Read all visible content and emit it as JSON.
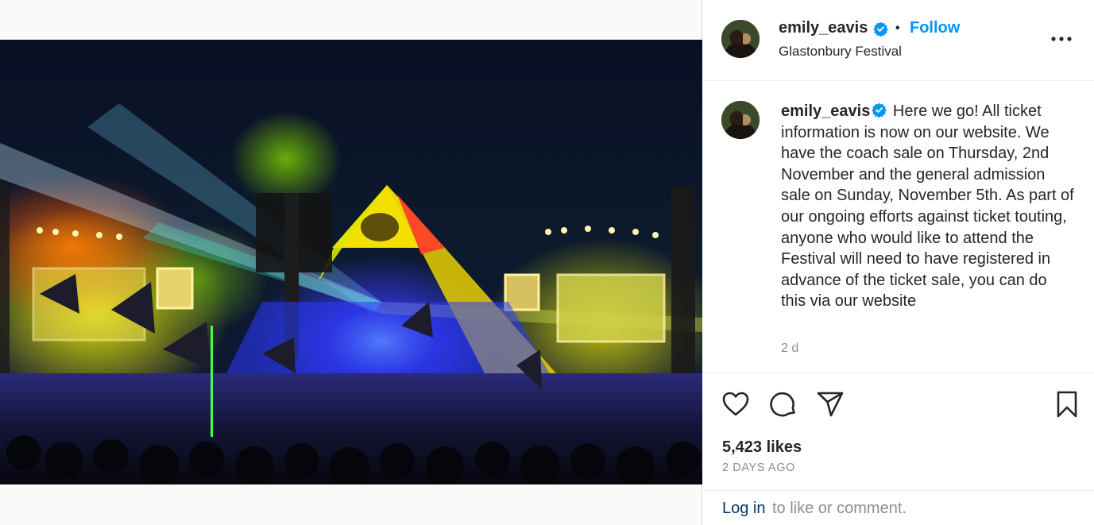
{
  "post": {
    "username": "emily_eavis",
    "follow_label": "Follow",
    "separator": "•",
    "location": "Glastonbury Festival",
    "caption": "Here we go! All ticket information is now on our website. We have the coach sale on Thursday, 2nd November and the general admission sale on Sunday, November 5th. As part of our ongoing efforts against ticket touting, anyone who would like to attend the Festival will need to have registered in advance of the ticket sale, you can do this via our website",
    "time_ago": "2 d",
    "likes": "5,423 likes",
    "date": "2 DAYS AGO"
  },
  "login": {
    "link_label": "Log in",
    "rest": "to like or comment."
  },
  "icons": {
    "verified": "verified-badge-icon",
    "more": "more-options-icon",
    "like": "heart-icon",
    "comment": "comment-icon",
    "share": "share-icon",
    "save": "bookmark-icon"
  },
  "colors": {
    "accent": "#0095f6",
    "link": "#00376b",
    "muted": "#8e8e8e",
    "text": "#262626"
  }
}
